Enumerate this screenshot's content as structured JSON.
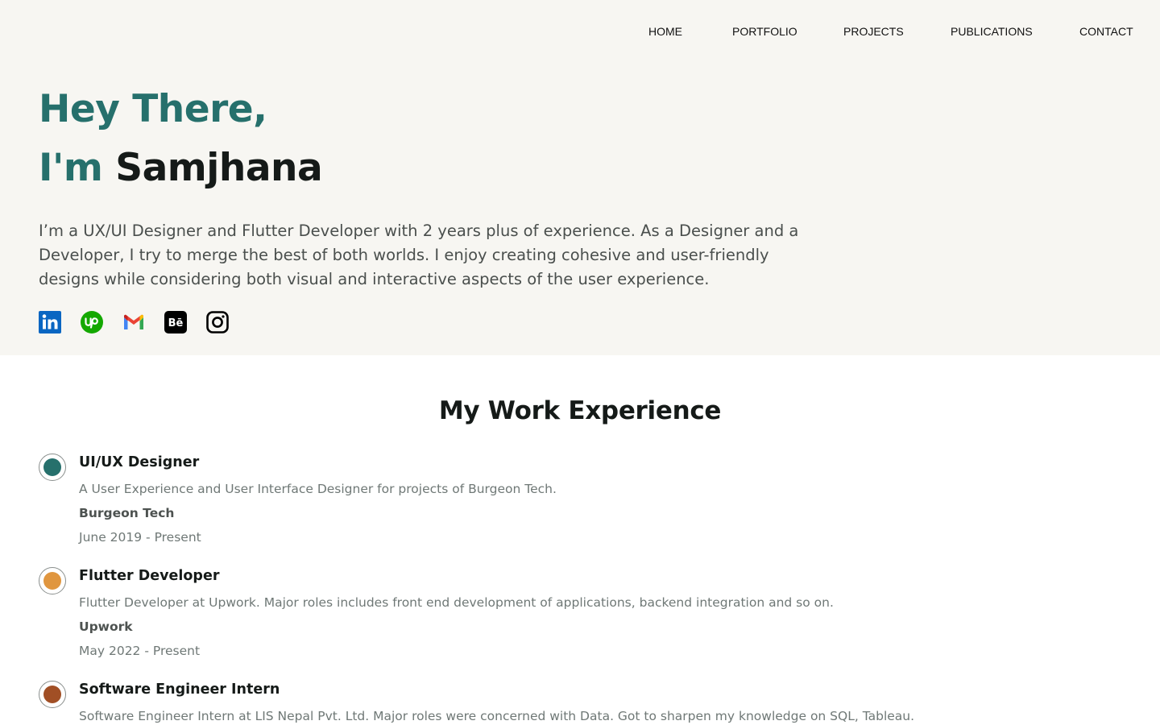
{
  "nav": {
    "items": [
      "HOME",
      "PORTFOLIO",
      "PROJECTS",
      "PUBLICATIONS",
      "CONTACT"
    ]
  },
  "hero": {
    "greeting": "Hey There,",
    "im": "I'm",
    "name": "Samjhana",
    "bio": "I’m a UX/UI Designer and Flutter Developer with 2 years plus of experience. As a Designer and a Developer, I try to merge the best of both worlds.  I enjoy creating cohesive and user-friendly designs while considering both visual and interactive aspects of the user experience.",
    "socials": [
      {
        "icon": "linkedin-icon",
        "color": "#0a66c2"
      },
      {
        "icon": "upwork-icon",
        "color": "#14a800"
      },
      {
        "icon": "gmail-icon",
        "color": "#ea4335"
      },
      {
        "icon": "behance-icon",
        "color": "#000000"
      },
      {
        "icon": "instagram-icon",
        "color": "#000000"
      }
    ]
  },
  "experience": {
    "title": "My Work Experience",
    "items": [
      {
        "role": "UI/UX Designer",
        "description": "A User Experience and User Interface Designer for projects of Burgeon Tech.",
        "company": "Burgeon Tech",
        "dates": "June 2019 - Present",
        "color": "#26706c"
      },
      {
        "role": "Flutter Developer",
        "description": "Flutter Developer at Upwork. Major roles includes front end development of applications, backend integration and so on.",
        "company": "Upwork",
        "dates": "May 2022 - Present",
        "color": "#e0963f"
      },
      {
        "role": "Software Engineer Intern",
        "description": "Software Engineer Intern at LIS Nepal Pvt. Ltd. Major roles were concerned with Data. Got to sharpen my knowledge on SQL, Tableau.",
        "company": "",
        "dates": "",
        "color": "#a14f25"
      }
    ]
  },
  "colors": {
    "accent": "#26706c",
    "hero_bg": "#f7f6f2",
    "text_dark": "#151a18",
    "text_muted": "#6f7876"
  }
}
